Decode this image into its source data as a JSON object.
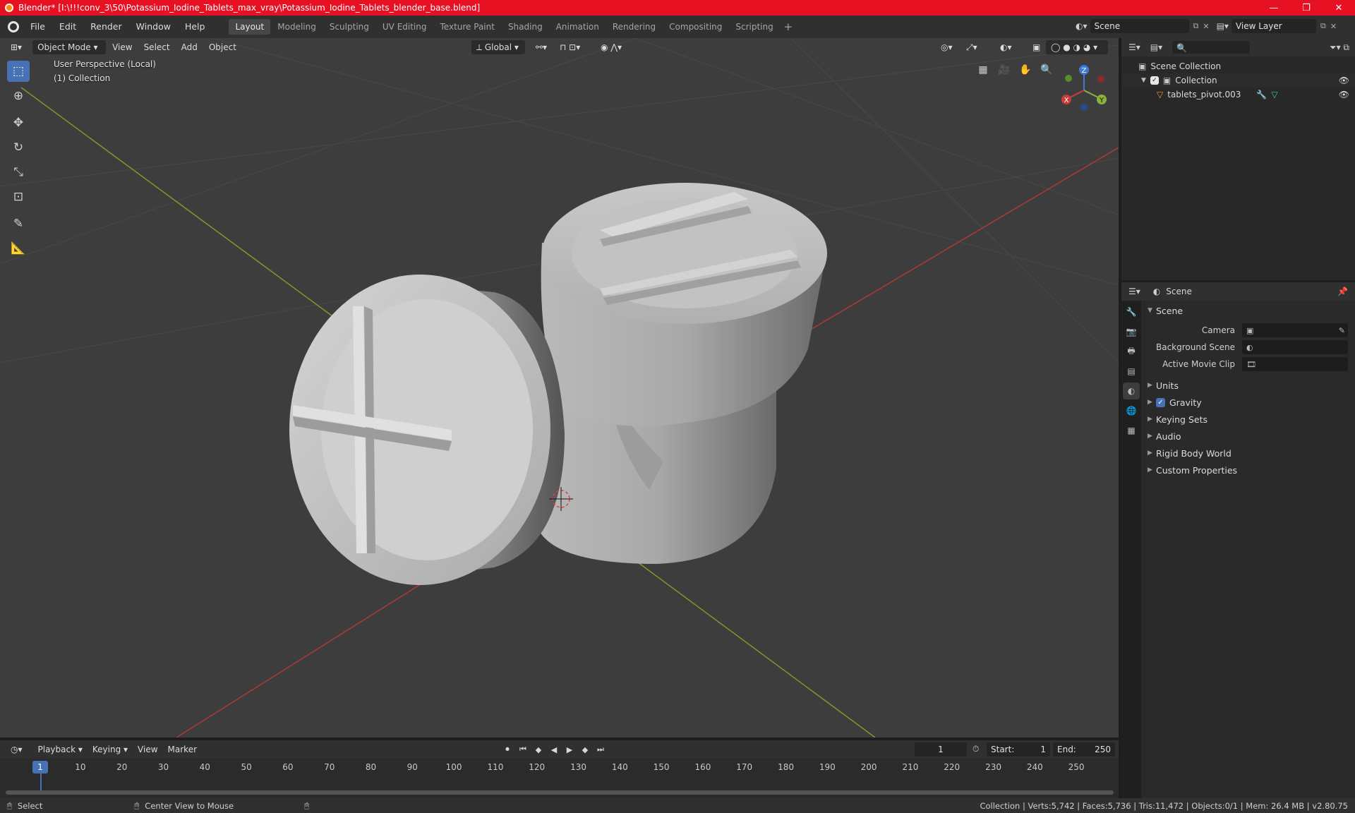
{
  "window": {
    "title": "Blender* [I:\\!!!conv_3\\50\\Potassium_Iodine_Tablets_max_vray\\Potassium_Iodine_Tablets_blender_base.blend]",
    "minimize": "—",
    "maximize": "❐",
    "close": "✕"
  },
  "menu": [
    "File",
    "Edit",
    "Render",
    "Window",
    "Help"
  ],
  "workspaces": [
    "Layout",
    "Modeling",
    "Sculpting",
    "UV Editing",
    "Texture Paint",
    "Shading",
    "Animation",
    "Rendering",
    "Compositing",
    "Scripting"
  ],
  "active_workspace": "Layout",
  "scene_field": "Scene",
  "view_layer_field": "View Layer",
  "viewport": {
    "mode": "Object Mode",
    "menus": [
      "View",
      "Select",
      "Add",
      "Object"
    ],
    "orientation": "Global",
    "perspective": "User Perspective (Local)",
    "collection": "(1) Collection",
    "gizmo": {
      "z": "Z",
      "x": "X",
      "y": "Y"
    }
  },
  "outliner": {
    "search_placeholder": "",
    "rows": [
      {
        "label": "Scene Collection"
      },
      {
        "label": "Collection"
      },
      {
        "label": "tablets_pivot.003"
      }
    ]
  },
  "properties": {
    "header": "Scene",
    "panel": "Scene",
    "fields": [
      {
        "label": "Camera"
      },
      {
        "label": "Background Scene"
      },
      {
        "label": "Active Movie Clip"
      }
    ],
    "sections": [
      "Units",
      "Gravity",
      "Keying Sets",
      "Audio",
      "Rigid Body World",
      "Custom Properties"
    ],
    "gravity_checked": true
  },
  "timeline": {
    "menus": [
      "Playback",
      "Keying",
      "View",
      "Marker"
    ],
    "current_frame": "1",
    "start_label": "Start:",
    "start": "1",
    "end_label": "End:",
    "end": "250",
    "ticks": [
      "1",
      "10",
      "20",
      "30",
      "40",
      "50",
      "60",
      "70",
      "80",
      "90",
      "100",
      "110",
      "120",
      "130",
      "140",
      "150",
      "160",
      "170",
      "180",
      "190",
      "200",
      "210",
      "220",
      "230",
      "240",
      "250"
    ]
  },
  "statusbar": {
    "left1": "Select",
    "left2": "Center View to Mouse",
    "right": "Collection | Verts:5,742 | Faces:5,736 | Tris:11,472 | Objects:0/1 | Mem: 26.4 MB | v2.80.75"
  },
  "colors": {
    "titlebar": "#e81123",
    "accent": "#4772b3",
    "x_axis": "#c83c3c",
    "y_axis": "#8ab13a",
    "z_axis": "#3f79d8"
  }
}
